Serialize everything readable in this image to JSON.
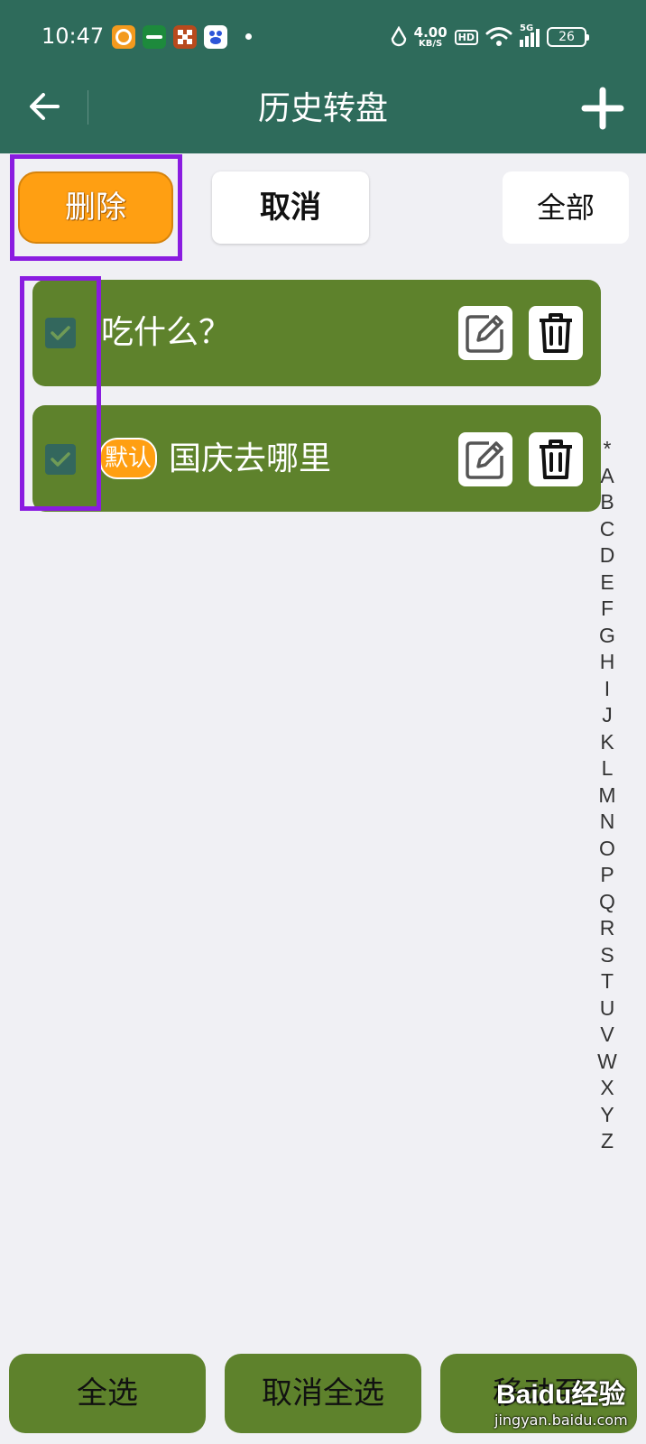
{
  "status_bar": {
    "time": "10:47",
    "net_speed_value": "4.00",
    "net_speed_unit": "KB/S",
    "hd": "HD",
    "network": "5G",
    "battery": "26"
  },
  "header": {
    "title": "历史转盘",
    "back_icon": "arrow-left-icon",
    "add_icon": "plus-icon"
  },
  "actions": {
    "delete_label": "删除",
    "cancel_label": "取消",
    "all_label": "全部"
  },
  "items": [
    {
      "title": "吃什么？",
      "checked": true,
      "is_default": false
    },
    {
      "title": "国庆去哪里",
      "checked": true,
      "is_default": true,
      "badge": "默认"
    }
  ],
  "alpha_index": [
    "*",
    "A",
    "B",
    "C",
    "D",
    "E",
    "F",
    "G",
    "H",
    "I",
    "J",
    "K",
    "L",
    "M",
    "N",
    "O",
    "P",
    "Q",
    "R",
    "S",
    "T",
    "U",
    "V",
    "W",
    "X",
    "Y",
    "Z"
  ],
  "bottom": {
    "select_all_label": "全选",
    "deselect_all_label": "取消全选",
    "move_label": "移动至"
  },
  "watermark": {
    "brand": "Baidu经验",
    "url": "jingyan.baidu.com"
  },
  "colors": {
    "app_bar": "#2e6b5b",
    "row_bg": "#5e822c",
    "accent_orange": "#ff9f12",
    "highlight": "#8a1ce0",
    "checkbox": "#33675d"
  }
}
